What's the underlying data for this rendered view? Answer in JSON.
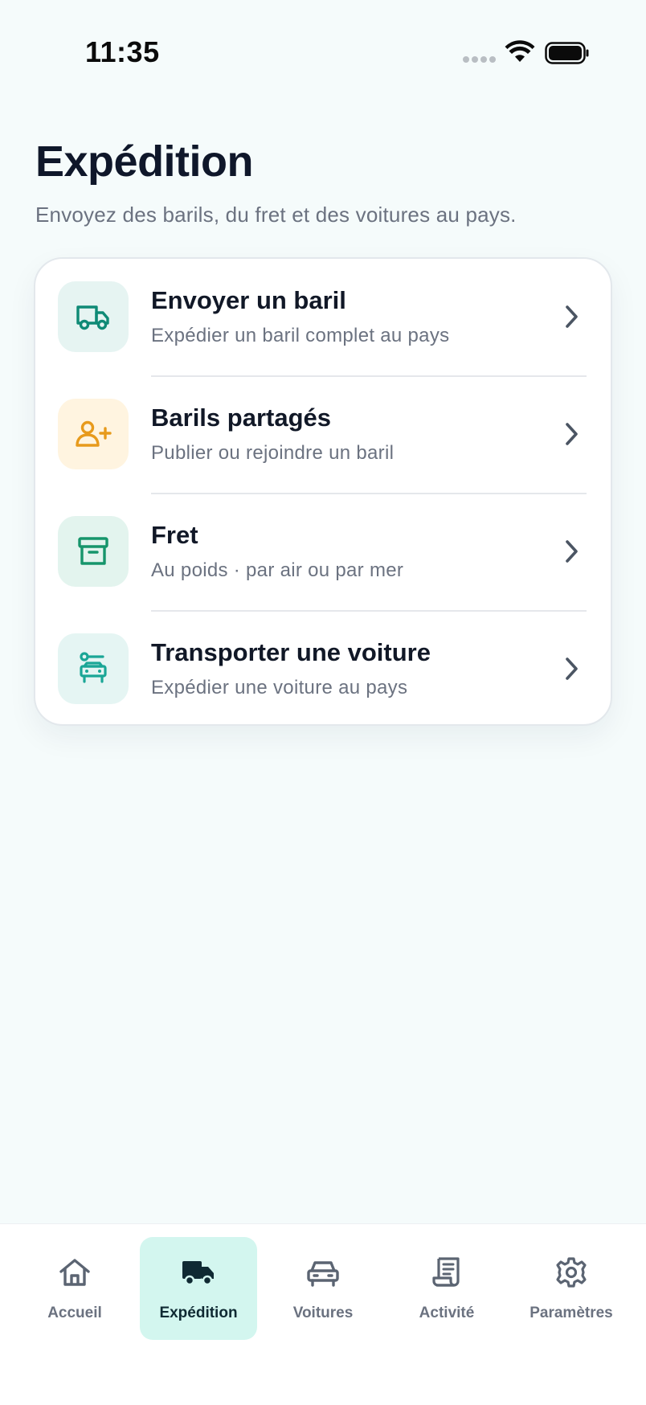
{
  "status_bar": {
    "time": "11:35"
  },
  "header": {
    "title": "Expédition",
    "subtitle": "Envoyez des barils, du fret et des voitures au pays."
  },
  "menu": {
    "items": [
      {
        "title": "Envoyer un baril",
        "description": "Expédier un baril complet au pays",
        "icon": "truck-icon",
        "tile_color": "#e6f4f2",
        "icon_color": "#0f8a76"
      },
      {
        "title": "Barils partagés",
        "description": "Publier ou rejoindre un baril",
        "icon": "user-plus-icon",
        "tile_color": "#fff4e0",
        "icon_color": "#e79a1c"
      },
      {
        "title": "Fret",
        "description": "Au poids · par air ou par mer",
        "icon": "archive-box-icon",
        "tile_color": "#e3f4ee",
        "icon_color": "#16956b"
      },
      {
        "title": "Transporter une voiture",
        "description": "Expédier une voiture au pays",
        "icon": "car-route-icon",
        "tile_color": "#e5f5f3",
        "icon_color": "#1aa696"
      }
    ]
  },
  "bottom_nav": {
    "tabs": [
      {
        "label": "Accueil",
        "icon": "home-icon",
        "active": false
      },
      {
        "label": "Expédition",
        "icon": "truck-icon",
        "active": true
      },
      {
        "label": "Voitures",
        "icon": "car-icon",
        "active": false
      },
      {
        "label": "Activité",
        "icon": "receipt-icon",
        "active": false
      },
      {
        "label": "Paramètres",
        "icon": "gear-icon",
        "active": false
      }
    ]
  },
  "colors": {
    "background": "#f5fbfb",
    "accent": "#0f8a76",
    "active_tab_bg": "#d3f6ef",
    "text_primary": "#111827",
    "text_secondary": "#6b7280"
  }
}
